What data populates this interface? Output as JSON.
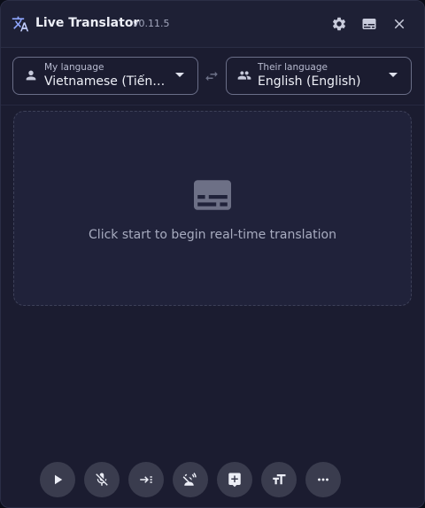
{
  "app": {
    "title": "Live Translator",
    "version": "v0.11.5"
  },
  "titlebar": {
    "icons": [
      "translate-icon",
      "gear-icon",
      "subtitles-icon",
      "close-icon"
    ]
  },
  "languages": {
    "mine": {
      "label": "My language",
      "value": "Vietnamese (Tiếng Việt)",
      "icon": "person-icon"
    },
    "theirs": {
      "label": "Their language",
      "value": "English (English)",
      "icon": "group-icon"
    },
    "swap_icon": "swap-icon"
  },
  "transcript": {
    "icon": "subtitles-icon",
    "hint": "Click start to begin real-time translation"
  },
  "controls": [
    {
      "name": "start-button",
      "icon": "play-icon"
    },
    {
      "name": "mute-mic-button",
      "icon": "mic-off-icon"
    },
    {
      "name": "indent-button",
      "icon": "format-indent-icon"
    },
    {
      "name": "voice-off-button",
      "icon": "voice-over-off-icon"
    },
    {
      "name": "add-feedback-button",
      "icon": "add-comment-icon"
    },
    {
      "name": "text-size-button",
      "icon": "text-size-icon"
    },
    {
      "name": "more-button",
      "icon": "more-horiz-icon"
    }
  ],
  "colors": {
    "background": "#1b1c30",
    "titlebar": "#1e2035",
    "panel": "#20223a",
    "control": "#3a3c4e",
    "text": "#eceef6",
    "muted": "#a7abbf"
  }
}
